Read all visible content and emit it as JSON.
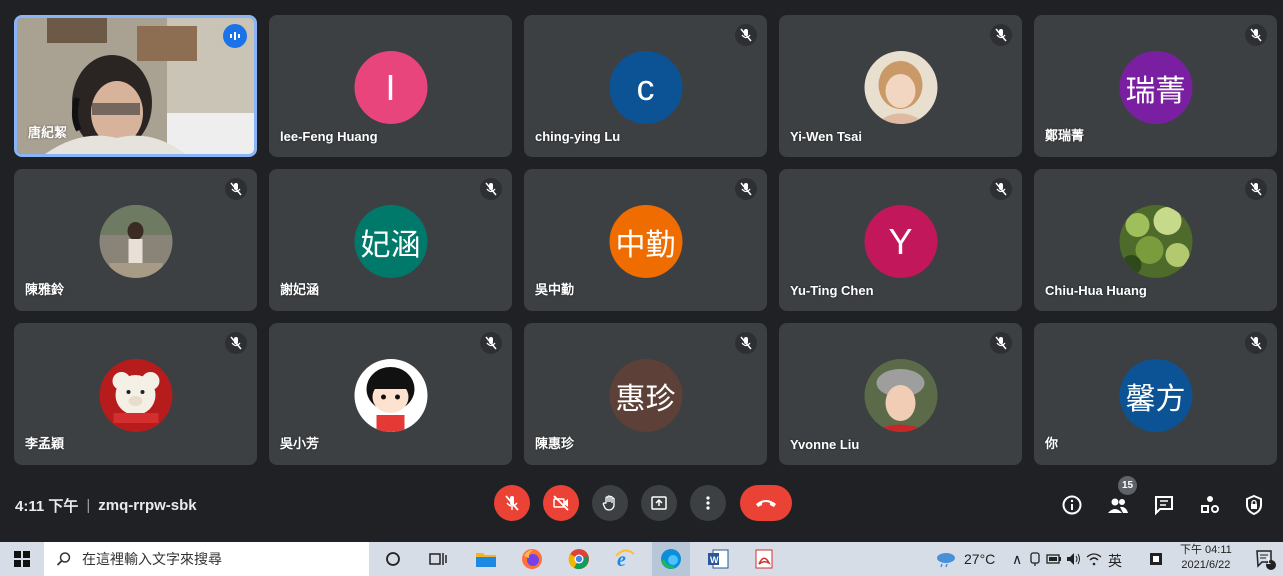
{
  "participants": [
    {
      "name": "唐紀絜",
      "type": "video",
      "speaking": true
    },
    {
      "name": "lee-Feng Huang",
      "initial": "I",
      "color": "#e8457c"
    },
    {
      "name": "ching-ying Lu",
      "initial": "c",
      "color": "#0b5394"
    },
    {
      "name": "Yi-Wen Tsai",
      "type": "photo",
      "photo": "toddler"
    },
    {
      "name": "鄭瑞菁",
      "initial": "瑞菁",
      "color": "#7b1fa2"
    },
    {
      "name": "陳雅鈴",
      "type": "photo",
      "photo": "woman-outdoor"
    },
    {
      "name": "謝妃涵",
      "initial": "妃涵",
      "color": "#00796b"
    },
    {
      "name": "吳中勤",
      "initial": "中勤",
      "color": "#ef6c00"
    },
    {
      "name": "Yu-Ting Chen",
      "initial": "Y",
      "color": "#c2185b"
    },
    {
      "name": "Chiu-Hua Huang",
      "type": "photo",
      "photo": "leaves"
    },
    {
      "name": "李孟穎",
      "type": "photo",
      "photo": "teddy-bear"
    },
    {
      "name": "吳小芳",
      "type": "photo",
      "photo": "cartoon-girl"
    },
    {
      "name": "陳惠珍",
      "initial": "惠珍",
      "color": "#5d4037"
    },
    {
      "name": "Yvonne Liu",
      "type": "photo",
      "photo": "woman-hat"
    },
    {
      "name": "你",
      "initial": "馨方",
      "color": "#0b5394"
    }
  ],
  "meeting": {
    "time": "4:11 下午",
    "separator": "|",
    "code": "zmq-rrpw-sbk"
  },
  "controls": {
    "mic": "mic-off-icon",
    "camera": "camera-off-icon",
    "raise_hand": "hand-icon",
    "present": "present-icon",
    "more": "more-vert-icon",
    "end_call": "phone-hangup-icon"
  },
  "right_panel": {
    "participant_count": "15"
  },
  "taskbar": {
    "search_placeholder": "在這裡輸入文字來搜尋",
    "temperature": "27°C",
    "ime": "英",
    "clock_time": "下午 04:11",
    "clock_date": "2021/6/22",
    "notification_count": "1"
  },
  "colors": {
    "tile_bg": "#3c4043",
    "page_bg": "#202124",
    "end_call": "#ea4335",
    "active_border": "#8ab4f8"
  }
}
